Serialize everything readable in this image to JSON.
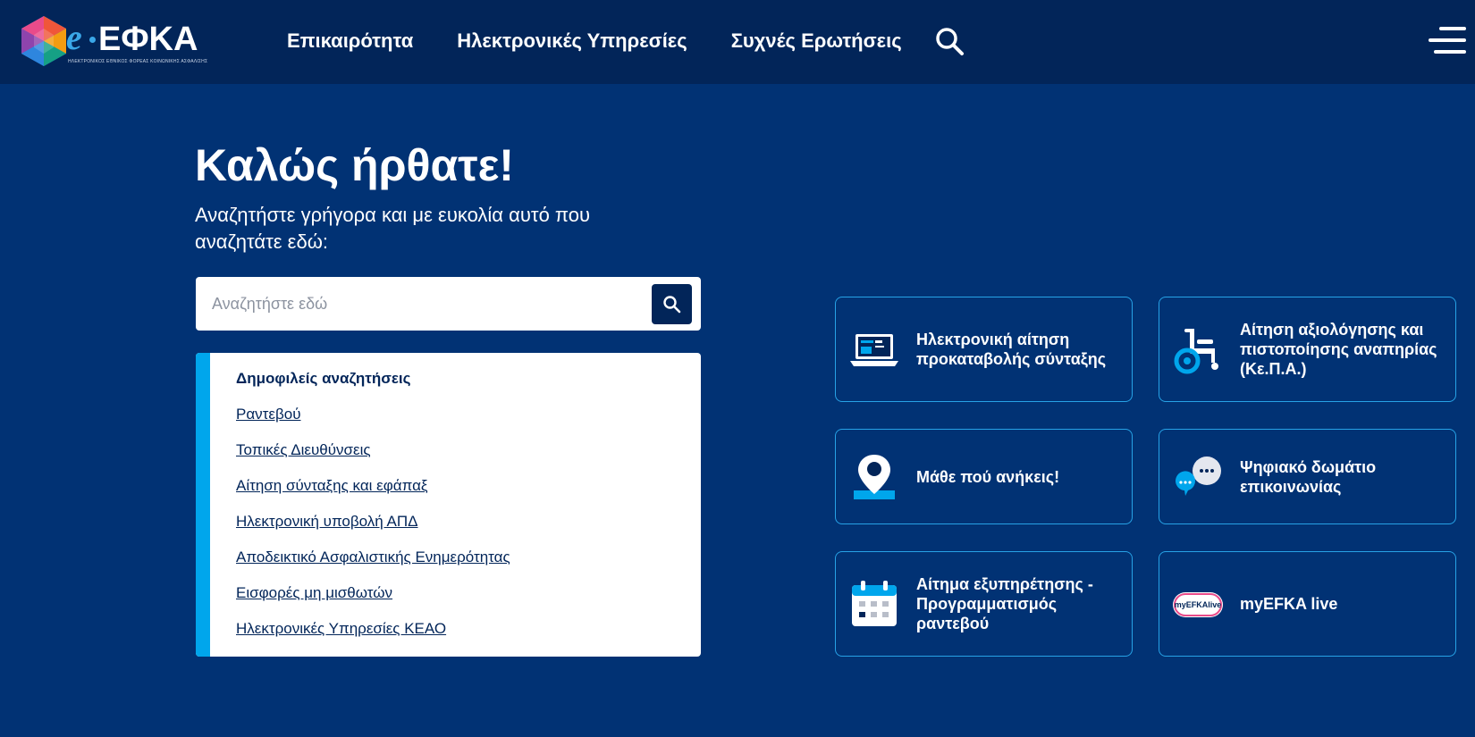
{
  "header": {
    "logo": {
      "prefix": "e",
      "wordmark": "ΕΦΚΑ",
      "subtitle": "ΗΛΕΚΤΡΟΝΙΚΟΣ ΕΘΝΙΚΟΣ ΦΟΡΕΑΣ ΚΟΙΝΩΝΙΚΗΣ ΑΣΦΑΛΙΣΗΣ"
    },
    "nav": [
      {
        "label": "Επικαιρότητα"
      },
      {
        "label": "Ηλεκτρονικές Υπηρεσίες"
      },
      {
        "label": "Συχνές Ερωτήσεις"
      }
    ],
    "search_icon": "search-icon",
    "menu_icon": "hamburger-menu-icon"
  },
  "hero": {
    "title": "Καλώς ήρθατε!",
    "subtitle": "Αναζητήστε γρήγορα και με ευκολία αυτό που αναζητάτε εδώ:"
  },
  "search": {
    "placeholder": "Αναζητήστε εδώ",
    "value": ""
  },
  "popular": {
    "title": "Δημοφιλείς αναζητήσεις",
    "items": [
      {
        "label": "Ραντεβού"
      },
      {
        "label": "Τοπικές Διευθύνσεις"
      },
      {
        "label": "Αίτηση σύνταξης και εφάπαξ"
      },
      {
        "label": "Ηλεκτρονική υποβολή ΑΠΔ"
      },
      {
        "label": "Αποδεικτικό Ασφαλιστικής Ενημερότητας"
      },
      {
        "label": "Εισφορές μη μισθωτών"
      },
      {
        "label": "Ηλεκτρονικές Υπηρεσίες ΚΕΑΟ"
      }
    ]
  },
  "cards": [
    {
      "label": "Ηλεκτρονική αίτηση προκαταβολής σύνταξης",
      "icon": "laptop-icon"
    },
    {
      "label": "Αίτηση αξιολόγησης και πιστοποίησης αναπηρίας (Κε.Π.Α.)",
      "icon": "wheelchair-icon"
    },
    {
      "label": "Μάθε πού ανήκεις!",
      "icon": "location-pin-icon"
    },
    {
      "label": "Ψηφιακό δωμάτιο επικοινωνίας",
      "icon": "chat-bubbles-icon"
    },
    {
      "label": "Αίτημα εξυπηρέτησης - Προγραμματισμός ραντεβού",
      "icon": "calendar-icon"
    },
    {
      "label": "myEFKA live",
      "icon": "myefka-live-logo",
      "logo_text": "myEFKAlive"
    }
  ],
  "colors": {
    "background": "#013274",
    "header": "#022559",
    "accent": "#00a6ec",
    "card_border": "#27a2e6"
  }
}
